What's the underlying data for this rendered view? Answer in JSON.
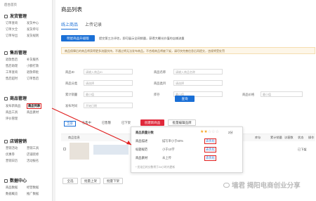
{
  "sidebar": {
    "home": "后台首页",
    "sections": [
      {
        "title": "发货管理"
      },
      {
        "title": "售后管理"
      },
      {
        "title": "商品管理"
      },
      {
        "title": "店铺营销"
      },
      {
        "title": "数据中心"
      }
    ],
    "items": [
      "订单查询",
      "发货中心",
      "订单大全",
      "发货单号",
      "订单导出",
      "发货规则",
      "退款售后",
      "补货服务",
      "售后助理",
      "小额打款",
      "工单查询",
      "退款审批",
      "售后超时",
      "订单售后",
      "发布新商品",
      "商品列表",
      "商品工具",
      "商品素材",
      "评价管理",
      "营销活动",
      "营销工具",
      "优惠券",
      "店铺装修",
      "营销日历",
      "活动报名",
      "商品数据",
      "经营数据",
      "数据概览",
      "推广数据"
    ]
  },
  "main": {
    "title": "商品列表",
    "tabs": [
      "线上商品",
      "上传记录"
    ],
    "ai_btn": "明星商品升级版",
    "ai_desc": "提交第三方评估，即可展示全网销量，获得大曝光价值的店铺流量",
    "warn": "商品保障后的商品将获得更多流量扶持，不通过将无法发布商品。不合格商品将被下架，请尽快完善信息后再提交，违规将受处罚",
    "filters": [
      {
        "label": "商品ID",
        "ph": "请输入商品ID"
      },
      {
        "label": "商品名称",
        "ph": "请输入商品名称"
      },
      {
        "label": "商品分类",
        "ph": "请选择"
      },
      {
        "label": "商品类目",
        "ph": "请选择"
      },
      {
        "label": "累计销量",
        "ph": "最小值"
      },
      {
        "label": "库存",
        "ph": "最小值"
      },
      {
        "label": "商品价格",
        "ph": "最小值"
      },
      {
        "label": "发布时间",
        "ph": "开始日期"
      }
    ],
    "search_btn": "查询",
    "ftabs": [
      "全部",
      "在售中",
      "已售罄",
      "已下架"
    ],
    "create_btn": "创建新商品",
    "batch_btn": "批量编辑品牌",
    "cols": [
      "商品信息",
      "价格",
      "库存",
      "累计销量",
      "访客数",
      "状态",
      "操作"
    ],
    "row": {
      "badge": "优化",
      "status": "已下架",
      "op": "编辑"
    },
    "bottom": [
      "全选",
      "批量上架",
      "批量下架"
    ]
  },
  "popup": {
    "title": "商品质量分数",
    "score": "2分",
    "rows": [
      {
        "name": "商品描述",
        "val": "描写率小于60%",
        "act": "去优化"
      },
      {
        "name": "标题规范",
        "val": "小于10字",
        "act": "去优化"
      },
      {
        "name": "商品素材",
        "val": "未上传",
        "act": "去优化"
      }
    ],
    "foot": "* 优化后的分数将于24小时内更新"
  },
  "watermark": "墙君 揭阳电商创业分享"
}
